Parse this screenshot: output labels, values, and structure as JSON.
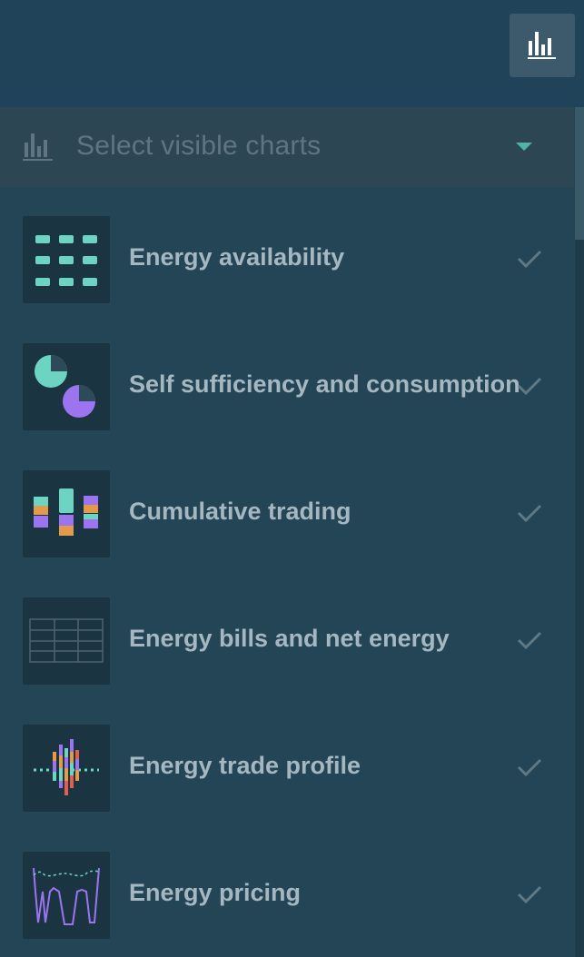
{
  "header": {
    "chart_toggle_icon": "bar-chart-icon"
  },
  "selector": {
    "icon": "bar-chart-icon",
    "placeholder": "Select visible charts",
    "caret_icon": "caret-down-icon",
    "accent_color": "#4fb3a6"
  },
  "charts": [
    {
      "label": "Energy availability",
      "icon": "grid-dots-icon",
      "checked": true
    },
    {
      "label": "Self sufficiency and consumption",
      "icon": "pie-charts-icon",
      "checked": true
    },
    {
      "label": "Cumulative trading",
      "icon": "stacked-bars-icon",
      "checked": true
    },
    {
      "label": "Energy bills and net energy",
      "icon": "table-icon",
      "checked": true
    },
    {
      "label": "Energy trade profile",
      "icon": "trade-profile-icon",
      "checked": true
    },
    {
      "label": "Energy pricing",
      "icon": "pricing-lines-icon",
      "checked": true
    }
  ],
  "colors": {
    "teal": "#6dd4c3",
    "purple": "#9d74f0",
    "orange": "#e39a4a",
    "check": "#5e7884"
  }
}
